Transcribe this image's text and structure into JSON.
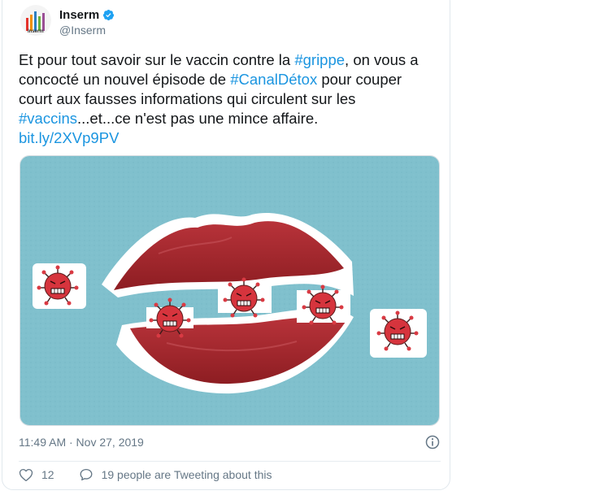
{
  "account": {
    "display_name": "Inserm",
    "handle": "@Inserm",
    "avatar_text": "Inserm",
    "verified": true
  },
  "tweet": {
    "segments": [
      {
        "text": "Et pour tout savoir sur le vaccin contre la ",
        "link": false
      },
      {
        "text": "#grippe",
        "link": true
      },
      {
        "text": ", on vous a concocté un nouvel épisode de ",
        "link": false
      },
      {
        "text": "#CanalDétox",
        "link": true
      },
      {
        "text": " pour couper court aux fausses informations qui circulent sur les ",
        "link": false
      },
      {
        "text": "#vaccins",
        "link": true
      },
      {
        "text": "...et...ce n'est pas une mince affaire.",
        "link": false
      },
      {
        "text": "bit.ly/2XVp9PV",
        "link": true
      }
    ],
    "timestamp": "11:49 AM · Nov 27, 2019"
  },
  "media": {
    "description_icon": "lips-virus-illustration",
    "background_color": "#7fbfcc",
    "lip_color": "#a8262b"
  },
  "actions": {
    "like_count": "12",
    "tweeting_text": "19 people are Tweeting about this"
  },
  "colors": {
    "link": "#1b95e0",
    "text": "#14171a",
    "muted": "#657786",
    "verified": "#1da1f2"
  },
  "icons": {
    "verified": "verified-badge-icon",
    "info": "info-icon",
    "like": "heart-icon",
    "comment": "comment-bubble-icon"
  }
}
